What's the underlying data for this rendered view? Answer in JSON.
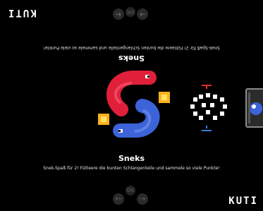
{
  "brand": "KUTI",
  "game": {
    "title": "Sneks",
    "description": "Snek-Spaß für 2! Fütteere die bunten Schlangenteile und sammele so viele Punkte!"
  },
  "nav": {
    "ok_label": "OK",
    "left_icon": "arrow-left-icon",
    "right_icon": "arrow-right-icon"
  },
  "colors": {
    "background": "#000000",
    "snake_red": "#e0203a",
    "snake_blue": "#3c63d8",
    "food_orange": "#ffb11a",
    "score_red": "#e03030",
    "score_blue": "#3a7ae0"
  }
}
